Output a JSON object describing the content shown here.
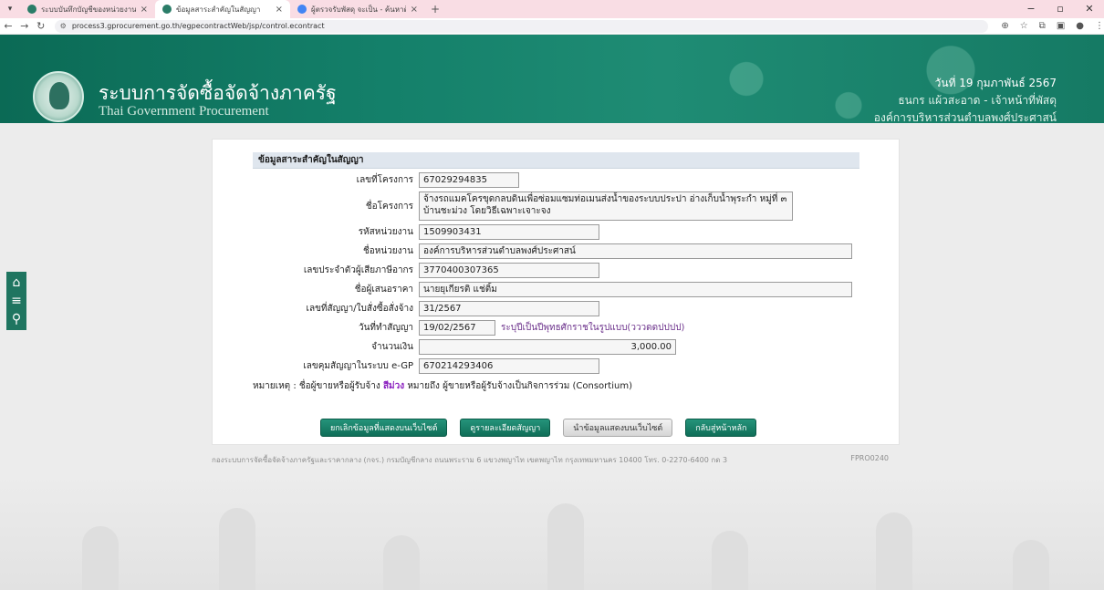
{
  "browser": {
    "tabs": [
      {
        "title": "ระบบบันทึกบัญชีของหน่วยงานภ",
        "active": false
      },
      {
        "title": "ข้อมูลสาระสำคัญในสัญญา",
        "active": true
      },
      {
        "title": "ผู้ตรวจรับพัสดุ จะเป็น - ค้นหาด้วย G",
        "active": false
      }
    ],
    "new_tab": "+",
    "url": "process3.gprocurement.go.th/egpecontractWeb/jsp/control.econtract"
  },
  "header": {
    "title": "ระบบการจัดซื้อจัดจ้างภาครัฐ",
    "subtitle": "Thai Government Procurement",
    "date": "วันที่ 19 กุมภาพันธ์ 2567",
    "user": "ธนกร แผ้วสะอาด - เจ้าหน้าที่พัสดุ",
    "org": "องค์การบริหารส่วนตำบลพงศ์ประศาสน์"
  },
  "form": {
    "heading": "ข้อมูลสาระสำคัญในสัญญา",
    "rows": [
      {
        "label": "เลขที่โครงการ",
        "value": "67029294835"
      },
      {
        "label": "ชื่อโครงการ",
        "value": "จ้างรถแมคโครขุดกลบดินเพื่อซ่อมแซมท่อเมนส่งน้ำของระบบประปา อ่างเก็บน้ำพุระกำ หมู่ที่ ๓ บ้านชะม่วง โดยวิธีเฉพาะเจาะจง"
      },
      {
        "label": "รหัสหน่วยงาน",
        "value": "1509903431"
      },
      {
        "label": "ชื่อหน่วยงาน",
        "value": "องค์การบริหารส่วนตำบลพงศ์ประศาสน์"
      },
      {
        "label": "เลขประจำตัวผู้เสียภาษีอากร",
        "value": "3770400307365"
      },
      {
        "label": "ชื่อผู้เสนอราคา",
        "value": "นายยุเกียรติ แช่ติ้ม"
      },
      {
        "label": "เลขที่สัญญา/ใบสั่งซื้อสั่งจ้าง",
        "value": "31/2567"
      },
      {
        "label": "วันที่ทำสัญญา",
        "value": "19/02/2567",
        "hint": "ระบุปีเป็นปีพุทธศักราชในรูปแบบ(วววดดปปปป)"
      },
      {
        "label": "จำนวนเงิน",
        "value": "3,000.00"
      },
      {
        "label": "เลขคุมสัญญาในระบบ e-GP",
        "value": "670214293406"
      }
    ],
    "note_prefix": "หมายเหตุ : ชื่อผู้ขายหรือผู้รับจ้าง",
    "note_highlight": "สีม่วง",
    "note_suffix": "หมายถึง ผู้ขายหรือผู้รับจ้างเป็นกิจการร่วม (Consortium)"
  },
  "buttons": {
    "cancel": "ยกเลิกข้อมูลที่แสดงบนเว็บไซต์",
    "view": "ดูรายละเอียดสัญญา",
    "publish": "นำข้อมูลแสดงบนเว็บไซต์",
    "back": "กลับสู่หน้าหลัก"
  },
  "footer": {
    "text": "กองระบบการจัดซื้อจัดจ้างภาครัฐและราคากลาง (กจร.) กรมบัญชีกลาง ถนนพระราม 6 แขวงพญาไท เขตพญาไท กรุงเทพมหานคร 10400 โทร. 0-2270-6400 กด 3",
    "code": "FPRO0240"
  },
  "colors": {
    "banner": "#14806a",
    "button": "#1a7f67",
    "consortium": "#8a1fbf"
  }
}
